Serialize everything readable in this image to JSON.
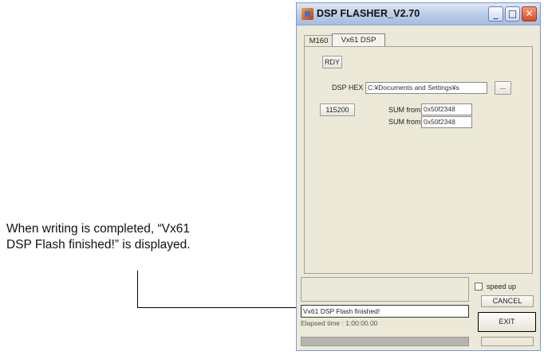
{
  "annotation": {
    "line1": "When writing is completed, “Vx61",
    "line2": "DSP Flash finished!” is displayed."
  },
  "window": {
    "title": "DSP FLASHER_V2.70",
    "buttons": {
      "minimize": "_",
      "maximize": "□",
      "close": "✕"
    }
  },
  "tabs": [
    {
      "label": "M160",
      "active": false
    },
    {
      "label": "Vx61 DSP",
      "active": true
    }
  ],
  "panel": {
    "rdy_label": "RDY",
    "dsp_hex_label": "DSP HEX",
    "dsp_hex_value": "C:¥Documents and Settings¥s",
    "browse_label": "...",
    "baud_label": "115200",
    "sum_from_label_1": "SUM from",
    "sum_from_value_1": "0x50f2348",
    "sum_from_label_2": "SUM from",
    "sum_from_value_2": "0x50f2348"
  },
  "bottom": {
    "speed_up_label": "speed up",
    "speed_up_checked": false,
    "cancel_label": "CANCEL",
    "exit_label": "EXIT",
    "message": "Vx61 DSP Flash finished!",
    "elapsed_text": "Elapsed time : 1:00:00.00",
    "progress": 1.0
  },
  "colors": {
    "window_bg": "#ece9d8",
    "close_button": "#d24d23",
    "title_gradient_top": "#dfe8f5"
  }
}
